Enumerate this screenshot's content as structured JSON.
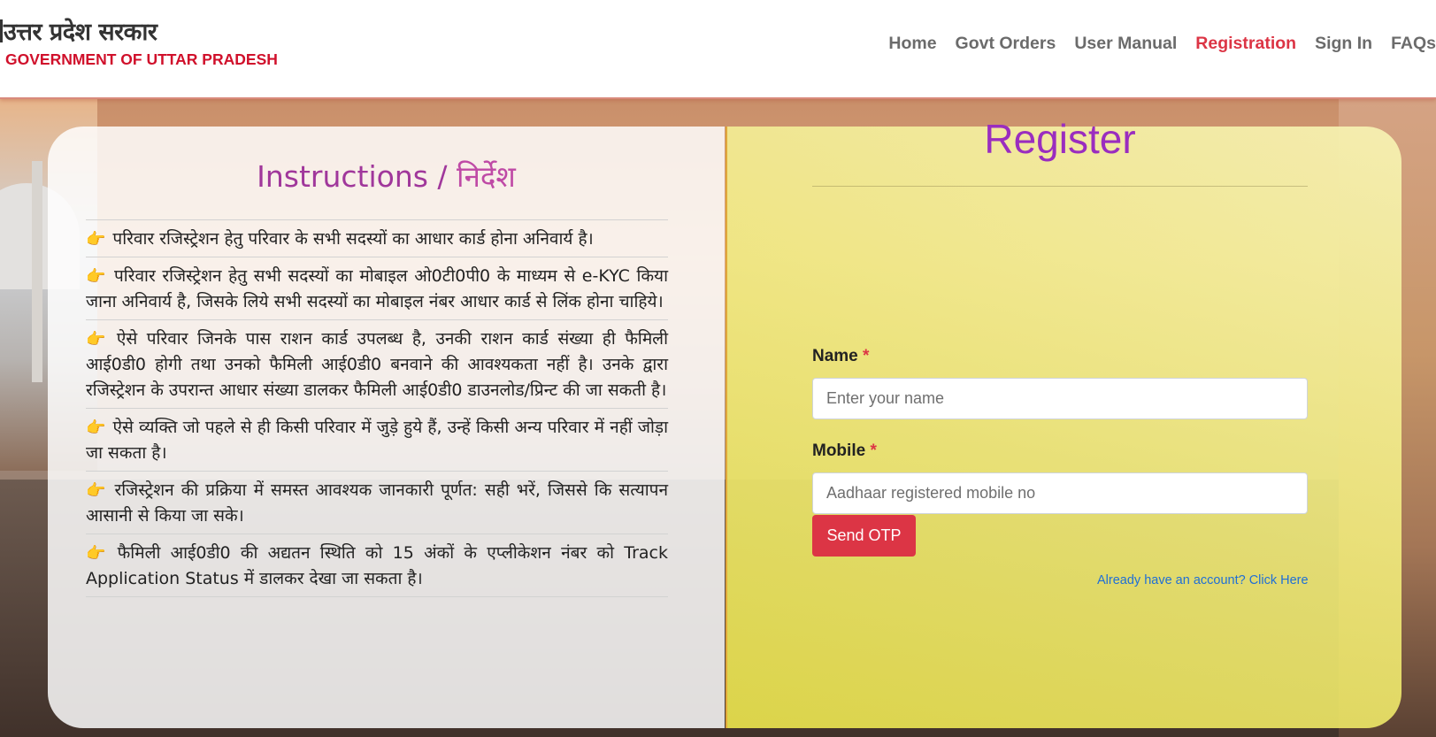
{
  "brand": {
    "hindi_name": "उत्तर प्रदेश सरकार",
    "english_name": "GOVERNMENT OF UTTAR PRADESH"
  },
  "nav": {
    "items": [
      {
        "label": "Home"
      },
      {
        "label": "Govt Orders"
      },
      {
        "label": "User Manual"
      },
      {
        "label": "Registration",
        "active": true
      },
      {
        "label": "Sign In"
      },
      {
        "label": "FAQs"
      }
    ]
  },
  "instructions": {
    "title_en": "Instructions / ",
    "title_hi": "निर्देश",
    "pointer_icon": "pointing-hand-icon",
    "items": [
      "परिवार रजिस्ट्रेशन हेतु परिवार के सभी सदस्यों का आधार कार्ड होना अनिवार्य है।",
      "परिवार रजिस्ट्रेशन हेतु सभी सदस्यों का मोबाइल ओ0टी0पी0 के माध्यम से e-KYC किया जाना अनिवार्य है, जिसके लिये सभी सदस्यों का मोबाइल नंबर आधार कार्ड से लिंक होना चाहिये।",
      "ऐसे परिवार जिनके पास राशन कार्ड उपलब्ध है, उनकी राशन कार्ड संख्या ही फैमिली आई0डी0 होगी तथा उनको फैमिली आई0डी0 बनवाने की आवश्यकता नहीं है। उनके द्वारा रजिस्ट्रेशन के उपरान्त आधार संख्या डालकर फैमिली आई0डी0 डाउनलोड/प्रिन्ट की जा सकती है।",
      "ऐसे व्यक्ति जो पहले से ही किसी परिवार में जुड़े हुये हैं, उन्हें किसी अन्य परिवार में नहीं जोड़ा जा सकता है।",
      "रजिस्ट्रेशन की प्रक्रिया में समस्त आवश्यक जानकारी पूर्णत: सही भरें, जिससे कि सत्यापन आसानी से किया जा सके।",
      "फैमिली आई0डी0 की अद्यतन स्थिति को 15 अंकों के एप्लीकेशन नंबर को Track Application Status में डालकर देखा जा सकता है।"
    ]
  },
  "register": {
    "title": "Register",
    "name_label": "Name",
    "name_placeholder": "Enter your name",
    "mobile_label": "Mobile",
    "mobile_placeholder": "Aadhaar registered mobile no",
    "required_mark": "*",
    "send_otp_label": "Send OTP",
    "login_link": "Already have an account? Click Here"
  },
  "colors": {
    "accent_red": "#dc3545",
    "title_purple": "#9a2dbf",
    "link_blue": "#1f6fd6"
  }
}
